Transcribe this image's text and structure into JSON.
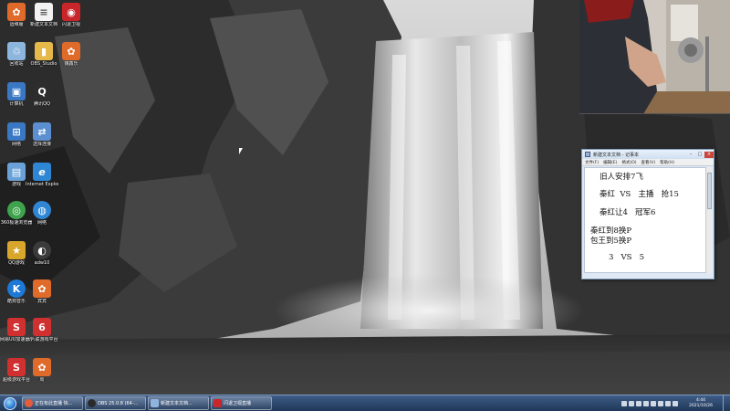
{
  "desktop_icons": [
    {
      "name": "icon-1",
      "label": "运维服",
      "color": "#e06a2a",
      "glyph": "✿"
    },
    {
      "name": "icon-2",
      "label": "新建文本文档",
      "color": "#f2f2f2",
      "glyph": "≡"
    },
    {
      "name": "icon-3",
      "label": "闪退卫视",
      "color": "#c8262a",
      "glyph": "◉"
    },
    {
      "name": "icon-4",
      "label": "回收站",
      "color": "#8cb6de",
      "glyph": "♲"
    },
    {
      "name": "icon-5",
      "label": "OBS_Studio",
      "color": "#e5b84a",
      "glyph": "▮"
    },
    {
      "name": "icon-6",
      "label": "魏鑫乐",
      "color": "#e06a2a",
      "glyph": "✿"
    },
    {
      "name": "icon-7",
      "label": "计算机",
      "color": "#3a78c4",
      "glyph": "▣"
    },
    {
      "name": "icon-8",
      "label": "腾讯QQ",
      "color": "#2d2d2d",
      "glyph": "Q"
    },
    {
      "name": "icon-9",
      "label": "网络",
      "color": "#3a78c4",
      "glyph": "⊞"
    },
    {
      "name": "icon-10",
      "label": "选择连接",
      "color": "#5b8fd0",
      "glyph": "⇄"
    },
    {
      "name": "icon-11",
      "label": "游戏",
      "color": "#6aa2d8",
      "glyph": "▤"
    },
    {
      "name": "icon-12",
      "label": "Internet Explorer",
      "color": "#2f86d4",
      "glyph": "e"
    },
    {
      "name": "icon-13",
      "label": "360极速浏览器",
      "color": "#3fa34d",
      "glyph": "◎"
    },
    {
      "name": "icon-14",
      "label": "网络",
      "color": "#2f86d4",
      "glyph": "◍"
    },
    {
      "name": "icon-15",
      "label": "QQ游戏",
      "color": "#d8a62b",
      "glyph": "★"
    },
    {
      "name": "icon-16",
      "label": "adw10",
      "color": "#3b3b3b",
      "glyph": "◐"
    },
    {
      "name": "icon-17",
      "label": "酷狗音乐",
      "color": "#1e78d6",
      "glyph": "K"
    },
    {
      "name": "icon-18",
      "label": "宾宾",
      "color": "#e06a2a",
      "glyph": "✿"
    },
    {
      "name": "icon-19",
      "label": "网易UU加速器平台",
      "color": "#d03030",
      "glyph": "S"
    },
    {
      "name": "icon-20",
      "label": "六六联游戏平台",
      "color": "#d03030",
      "glyph": "6"
    },
    {
      "name": "icon-21",
      "label": "超级游戏平台",
      "color": "#d03030",
      "glyph": "S"
    },
    {
      "name": "icon-22",
      "label": "周",
      "color": "#e06a2a",
      "glyph": "✿"
    }
  ],
  "notepad": {
    "title": "新建文本文档 - 记事本",
    "menu": [
      "文件(F)",
      "编辑(E)",
      "格式(O)",
      "查看(V)",
      "帮助(H)"
    ],
    "lines": [
      "旧人安排7飞",
      "秦红  VS   主播   抢15",
      "秦红让4   冠军6",
      "秦红到8换P",
      "包王到5换P",
      "3   VS   5"
    ]
  },
  "taskbar": {
    "items": [
      {
        "label": "正在有此直播  快...",
        "color": "#e45c3a"
      },
      {
        "label": "OBS 25.0.8 (64-...",
        "color": "#2b2b2b"
      },
      {
        "label": "新建文本文档...",
        "color": "#8fb4dd"
      },
      {
        "label": "闪退卫视直播",
        "color": "#c8262a"
      }
    ],
    "clock_time": "4:44",
    "clock_date": "2021/10/26"
  }
}
